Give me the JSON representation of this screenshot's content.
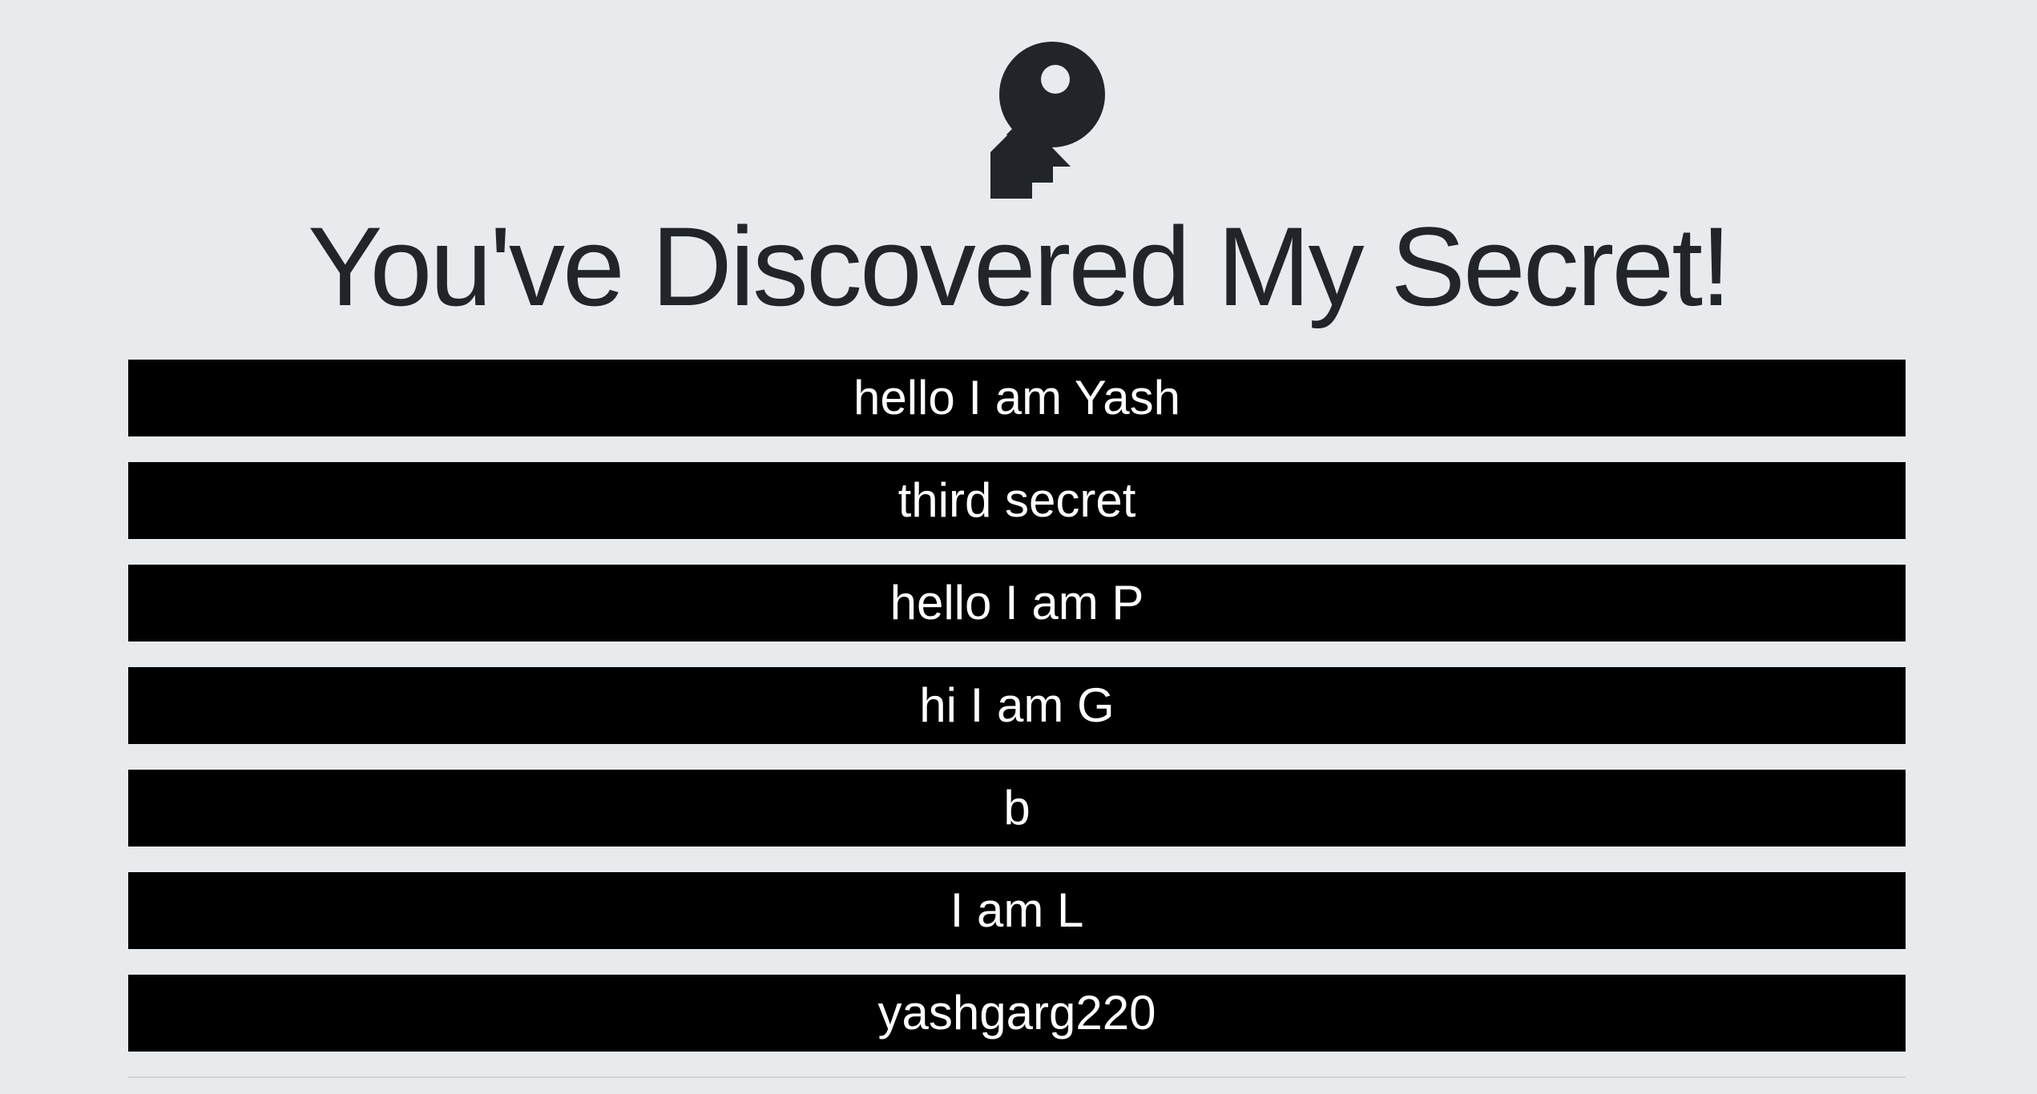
{
  "header": {
    "icon": "key-icon",
    "title": "You've Discovered My Secret!"
  },
  "secrets": [
    "hello I am Yash",
    "third secret",
    "hello I am P",
    "hi I am G",
    "b",
    "I am L",
    "yashgarg220"
  ],
  "colors": {
    "background": "#e8ebee",
    "text": "#212529",
    "secret_background": "#000000",
    "secret_text": "#ffffff"
  }
}
